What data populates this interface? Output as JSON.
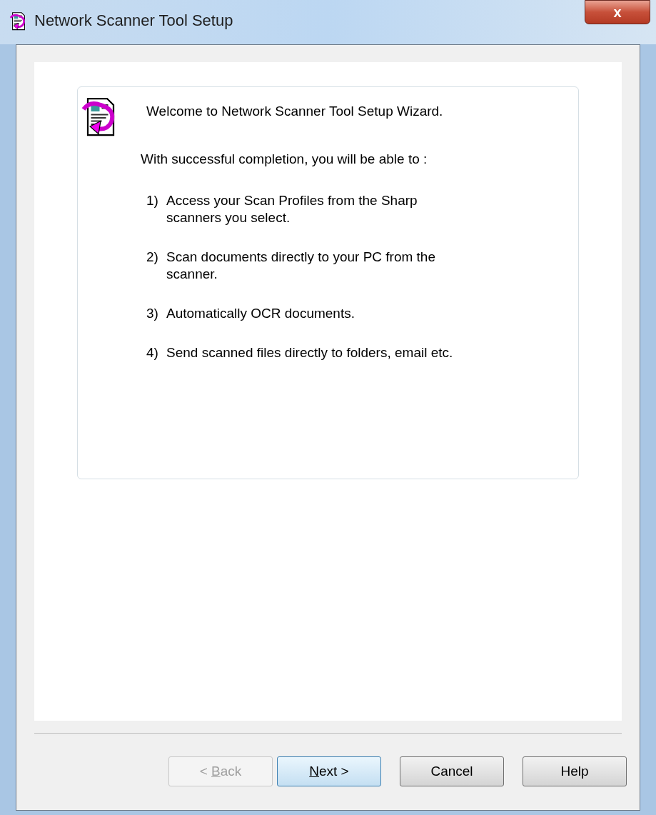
{
  "window": {
    "title": "Network Scanner Tool Setup",
    "close": "x"
  },
  "welcome": {
    "heading": "Welcome to Network Scanner Tool Setup Wizard.",
    "intro": "With successful completion, you will be able to :",
    "items": [
      {
        "number": "1)",
        "text": "Access your Scan Profiles from the Sharp\nscanners you select."
      },
      {
        "number": "2)",
        "text": "Scan documents directly to your PC from the\nscanner."
      },
      {
        "number": "3)",
        "text": "Automatically OCR documents."
      },
      {
        "number": "4)",
        "text": "Send scanned files directly to folders, email etc."
      }
    ]
  },
  "buttons": [
    {
      "label_before": "< ",
      "access_key": "B",
      "label_after": "ack",
      "disabled": true,
      "default": false
    },
    {
      "access_key": "N",
      "label_after": "ext >",
      "disabled": false,
      "default": true
    },
    {
      "label": "Cancel",
      "disabled": false,
      "default": false
    },
    {
      "label": "Help",
      "disabled": false,
      "default": false
    }
  ]
}
